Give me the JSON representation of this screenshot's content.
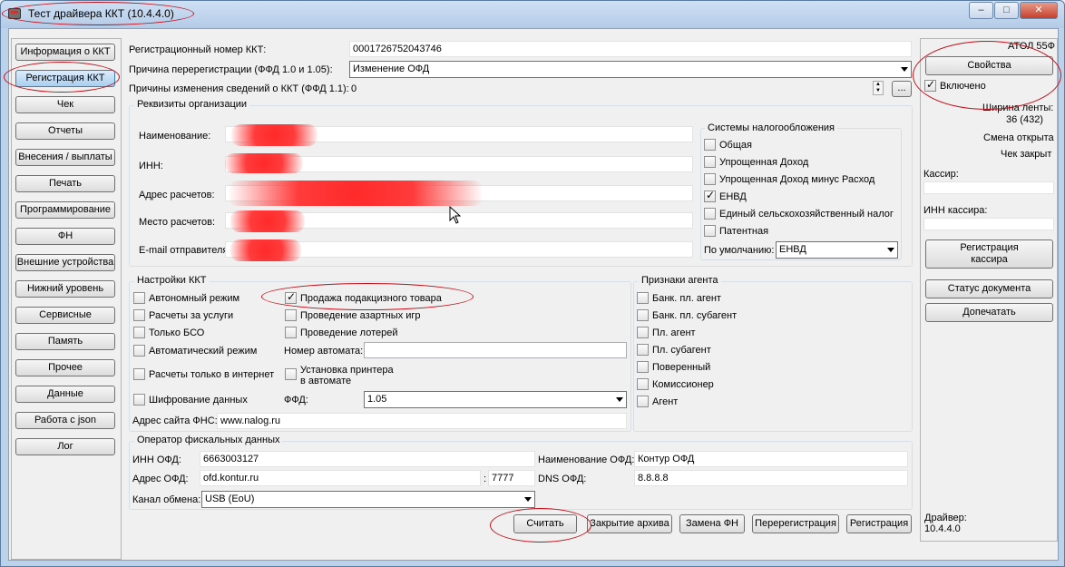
{
  "window": {
    "title": "Тест драйвера ККТ (10.4.4.0)",
    "min": "–",
    "max": "□",
    "close": "✕"
  },
  "nav": [
    "Информация о ККТ",
    "Регистрация ККТ",
    "Чек",
    "Отчеты",
    "Внесения / выплаты",
    "Печать",
    "Программирование",
    "ФН",
    "Внешние устройства",
    "Нижний уровень",
    "Сервисные",
    "Память",
    "Прочее",
    "Данные",
    "Работа с json",
    "Лог"
  ],
  "reg": {
    "regnum_label": "Регистрационный номер ККТ:",
    "regnum_value": "0001726752043746",
    "reason_label": "Причина перерегистрации (ФФД 1.0 и 1.05):",
    "reason_value": "Изменение ОФД",
    "changes_label": "Причины изменения сведений о ККТ (ФФД 1.1):",
    "changes_value": "0",
    "changes_btn": "..."
  },
  "org": {
    "title": "Реквизиты организации",
    "name_label": "Наименование:",
    "inn_label": "ИНН:",
    "address_label": "Адрес расчетов:",
    "place_label": "Место расчетов:",
    "email_label": "E-mail отправителя:"
  },
  "tax": {
    "title": "Системы налогообложения",
    "items": [
      {
        "label": "Общая",
        "checked": false
      },
      {
        "label": "Упрощенная Доход",
        "checked": false
      },
      {
        "label": "Упрощенная Доход минус Расход",
        "checked": false
      },
      {
        "label": "ЕНВД",
        "checked": true
      },
      {
        "label": "Единый сельскохозяйственный налог",
        "checked": false
      },
      {
        "label": "Патентная",
        "checked": false
      }
    ],
    "default_label": "По умолчанию:",
    "default_value": "ЕНВД"
  },
  "settings": {
    "title": "Настройки ККТ",
    "autonomous": "Автономный режим",
    "excise": "Продажа подакцизного товара",
    "services": "Расчеты за услуги",
    "gambling": "Проведение азартных игр",
    "bso": "Только БСО",
    "lottery": "Проведение лотерей",
    "automatic": "Автоматический режим",
    "automat_number_label": "Номер автомата:",
    "internet": "Расчеты только в интернет",
    "printer_install": "Установка принтера\nв автомате",
    "encryption": "Шифрование данных",
    "ffd_label": "ФФД:",
    "ffd_value": "1.05",
    "fns_site_label": "Адрес сайта ФНС:",
    "fns_site_value": "www.nalog.ru"
  },
  "agent": {
    "title": "Признаки агента",
    "items": [
      "Банк. пл. агент",
      "Банк. пл. субагент",
      "Пл. агент",
      "Пл. субагент",
      "Поверенный",
      "Комиссионер",
      "Агент"
    ]
  },
  "ofd": {
    "title": "Оператор фискальных данных",
    "inn_label": "ИНН ОФД:",
    "inn_value": "6663003127",
    "name_label": "Наименование ОФД:",
    "name_value": "Контур ОФД",
    "address_label": "Адрес ОФД:",
    "address_value": "ofd.kontur.ru",
    "port_sep": ":",
    "port_value": "7777",
    "dns_label": "DNS ОФД:",
    "dns_value": "8.8.8.8",
    "channel_label": "Канал обмена:",
    "channel_value": "USB (EoU)"
  },
  "actions": {
    "read": "Считать",
    "close_archive": "Закрытие архива",
    "replace_fn": "Замена ФН",
    "reregister": "Перерегистрация",
    "register": "Регистрация"
  },
  "right": {
    "model": "АТОЛ 55Ф",
    "properties": "Свойства",
    "enabled": "Включено",
    "tape_width_label": "Ширина ленты:",
    "tape_width_value": "36 (432)",
    "shift_status": "Смена открыта",
    "check_status": "Чек закрыт",
    "cashier_label": "Кассир:",
    "cashier_inn_label": "ИНН кассира:",
    "register_cashier": "Регистрация\nкассира",
    "doc_status": "Статус документа",
    "reprint": "Допечатать",
    "driver_label": "Драйвер:",
    "driver_version": "10.4.4.0"
  }
}
